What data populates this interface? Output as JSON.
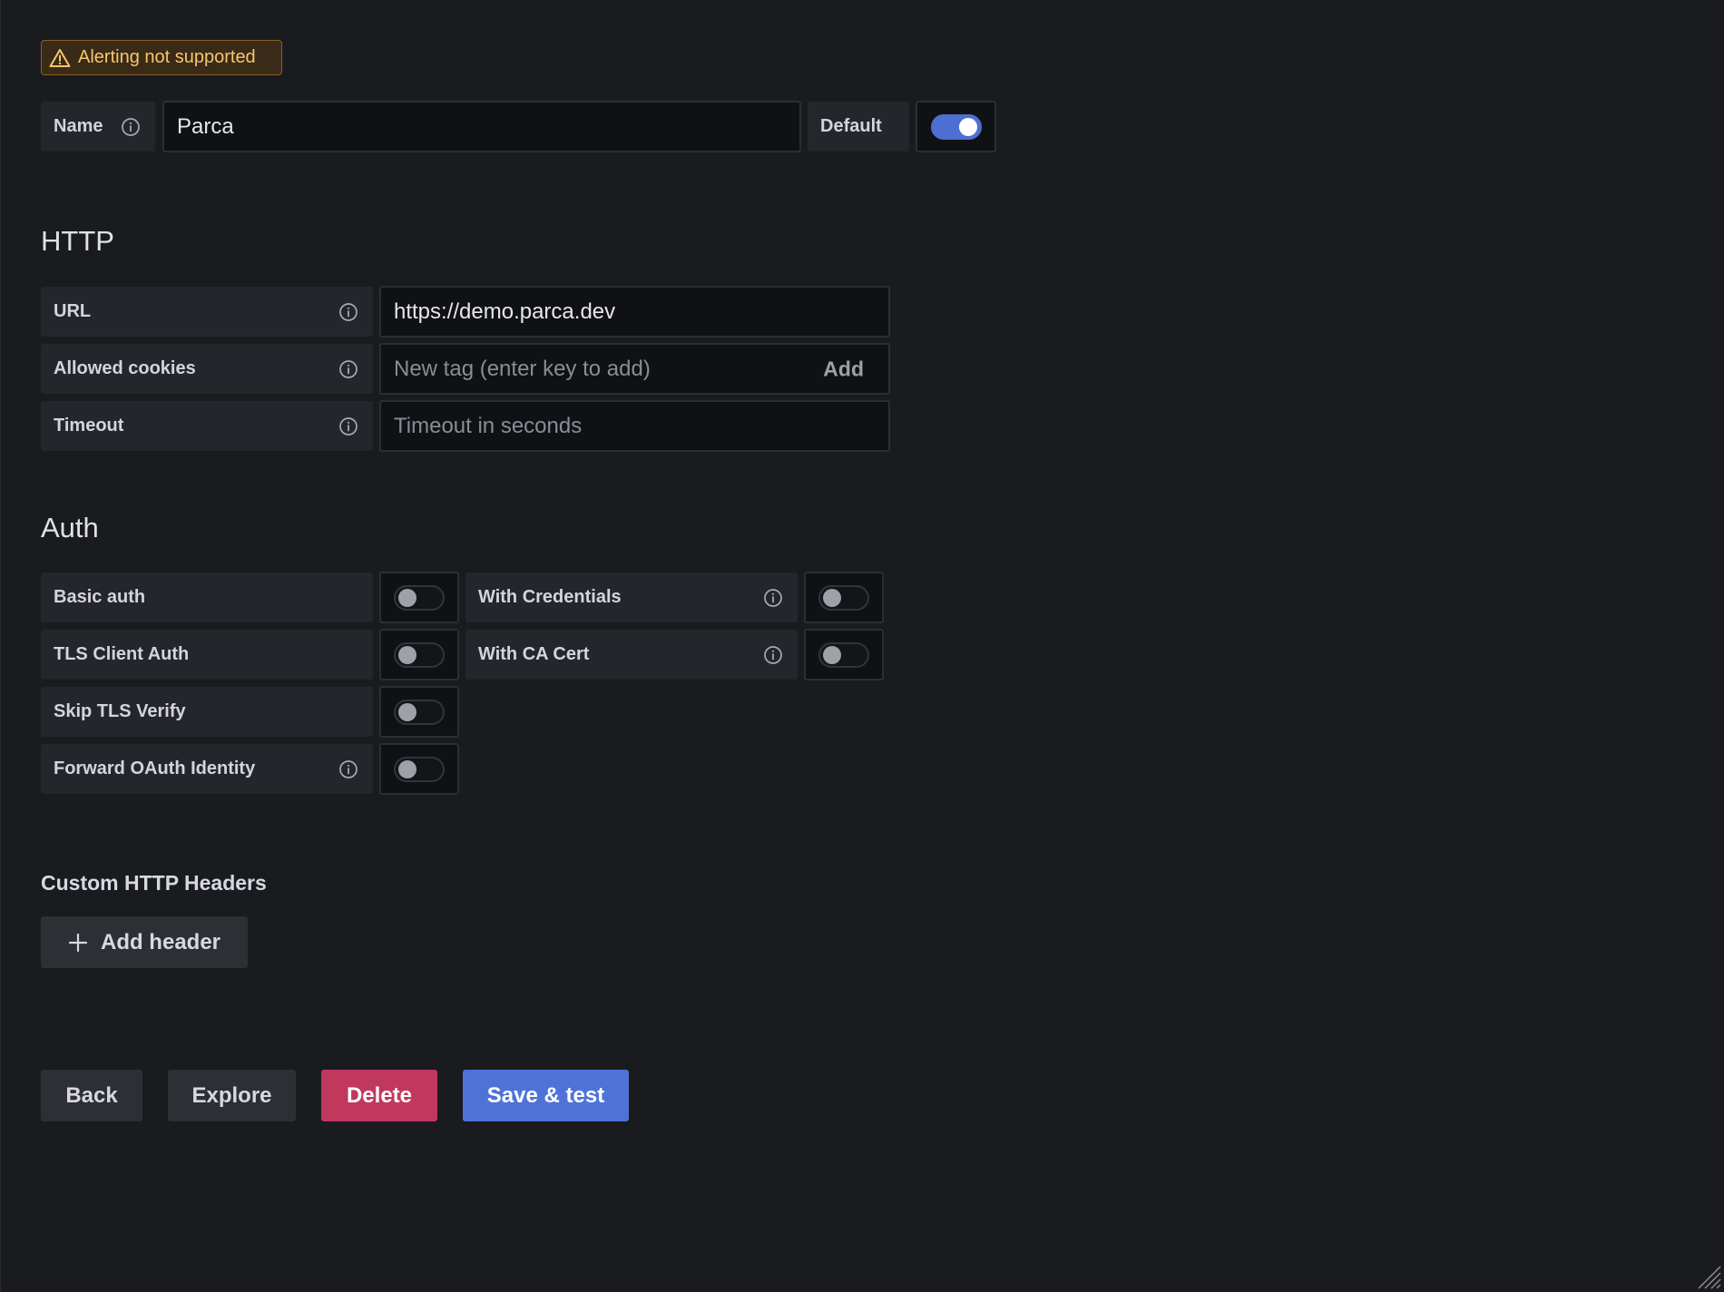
{
  "alert": {
    "text": "Alerting not supported",
    "icon": "warning-triangle-icon",
    "color": "#f6c66b"
  },
  "name_row": {
    "label": "Name",
    "value": "Parca",
    "default_label": "Default",
    "default_on": true
  },
  "http": {
    "title": "HTTP",
    "url_label": "URL",
    "url_value": "https://demo.parca.dev",
    "cookies_label": "Allowed cookies",
    "cookies_placeholder": "New tag (enter key to add)",
    "cookies_add": "Add",
    "timeout_label": "Timeout",
    "timeout_placeholder": "Timeout in seconds"
  },
  "auth": {
    "title": "Auth",
    "basic_auth": "Basic auth",
    "with_credentials": "With Credentials",
    "tls_client_auth": "TLS Client Auth",
    "with_ca_cert": "With CA Cert",
    "skip_tls_verify": "Skip TLS Verify",
    "forward_oauth": "Forward OAuth Identity"
  },
  "headers": {
    "title": "Custom HTTP Headers",
    "add_button": "Add header"
  },
  "actions": {
    "back": "Back",
    "explore": "Explore",
    "delete": "Delete",
    "save": "Save & test"
  },
  "colors": {
    "accent": "#4f72d8",
    "danger": "#c0385e",
    "background": "#1a1b1f"
  }
}
